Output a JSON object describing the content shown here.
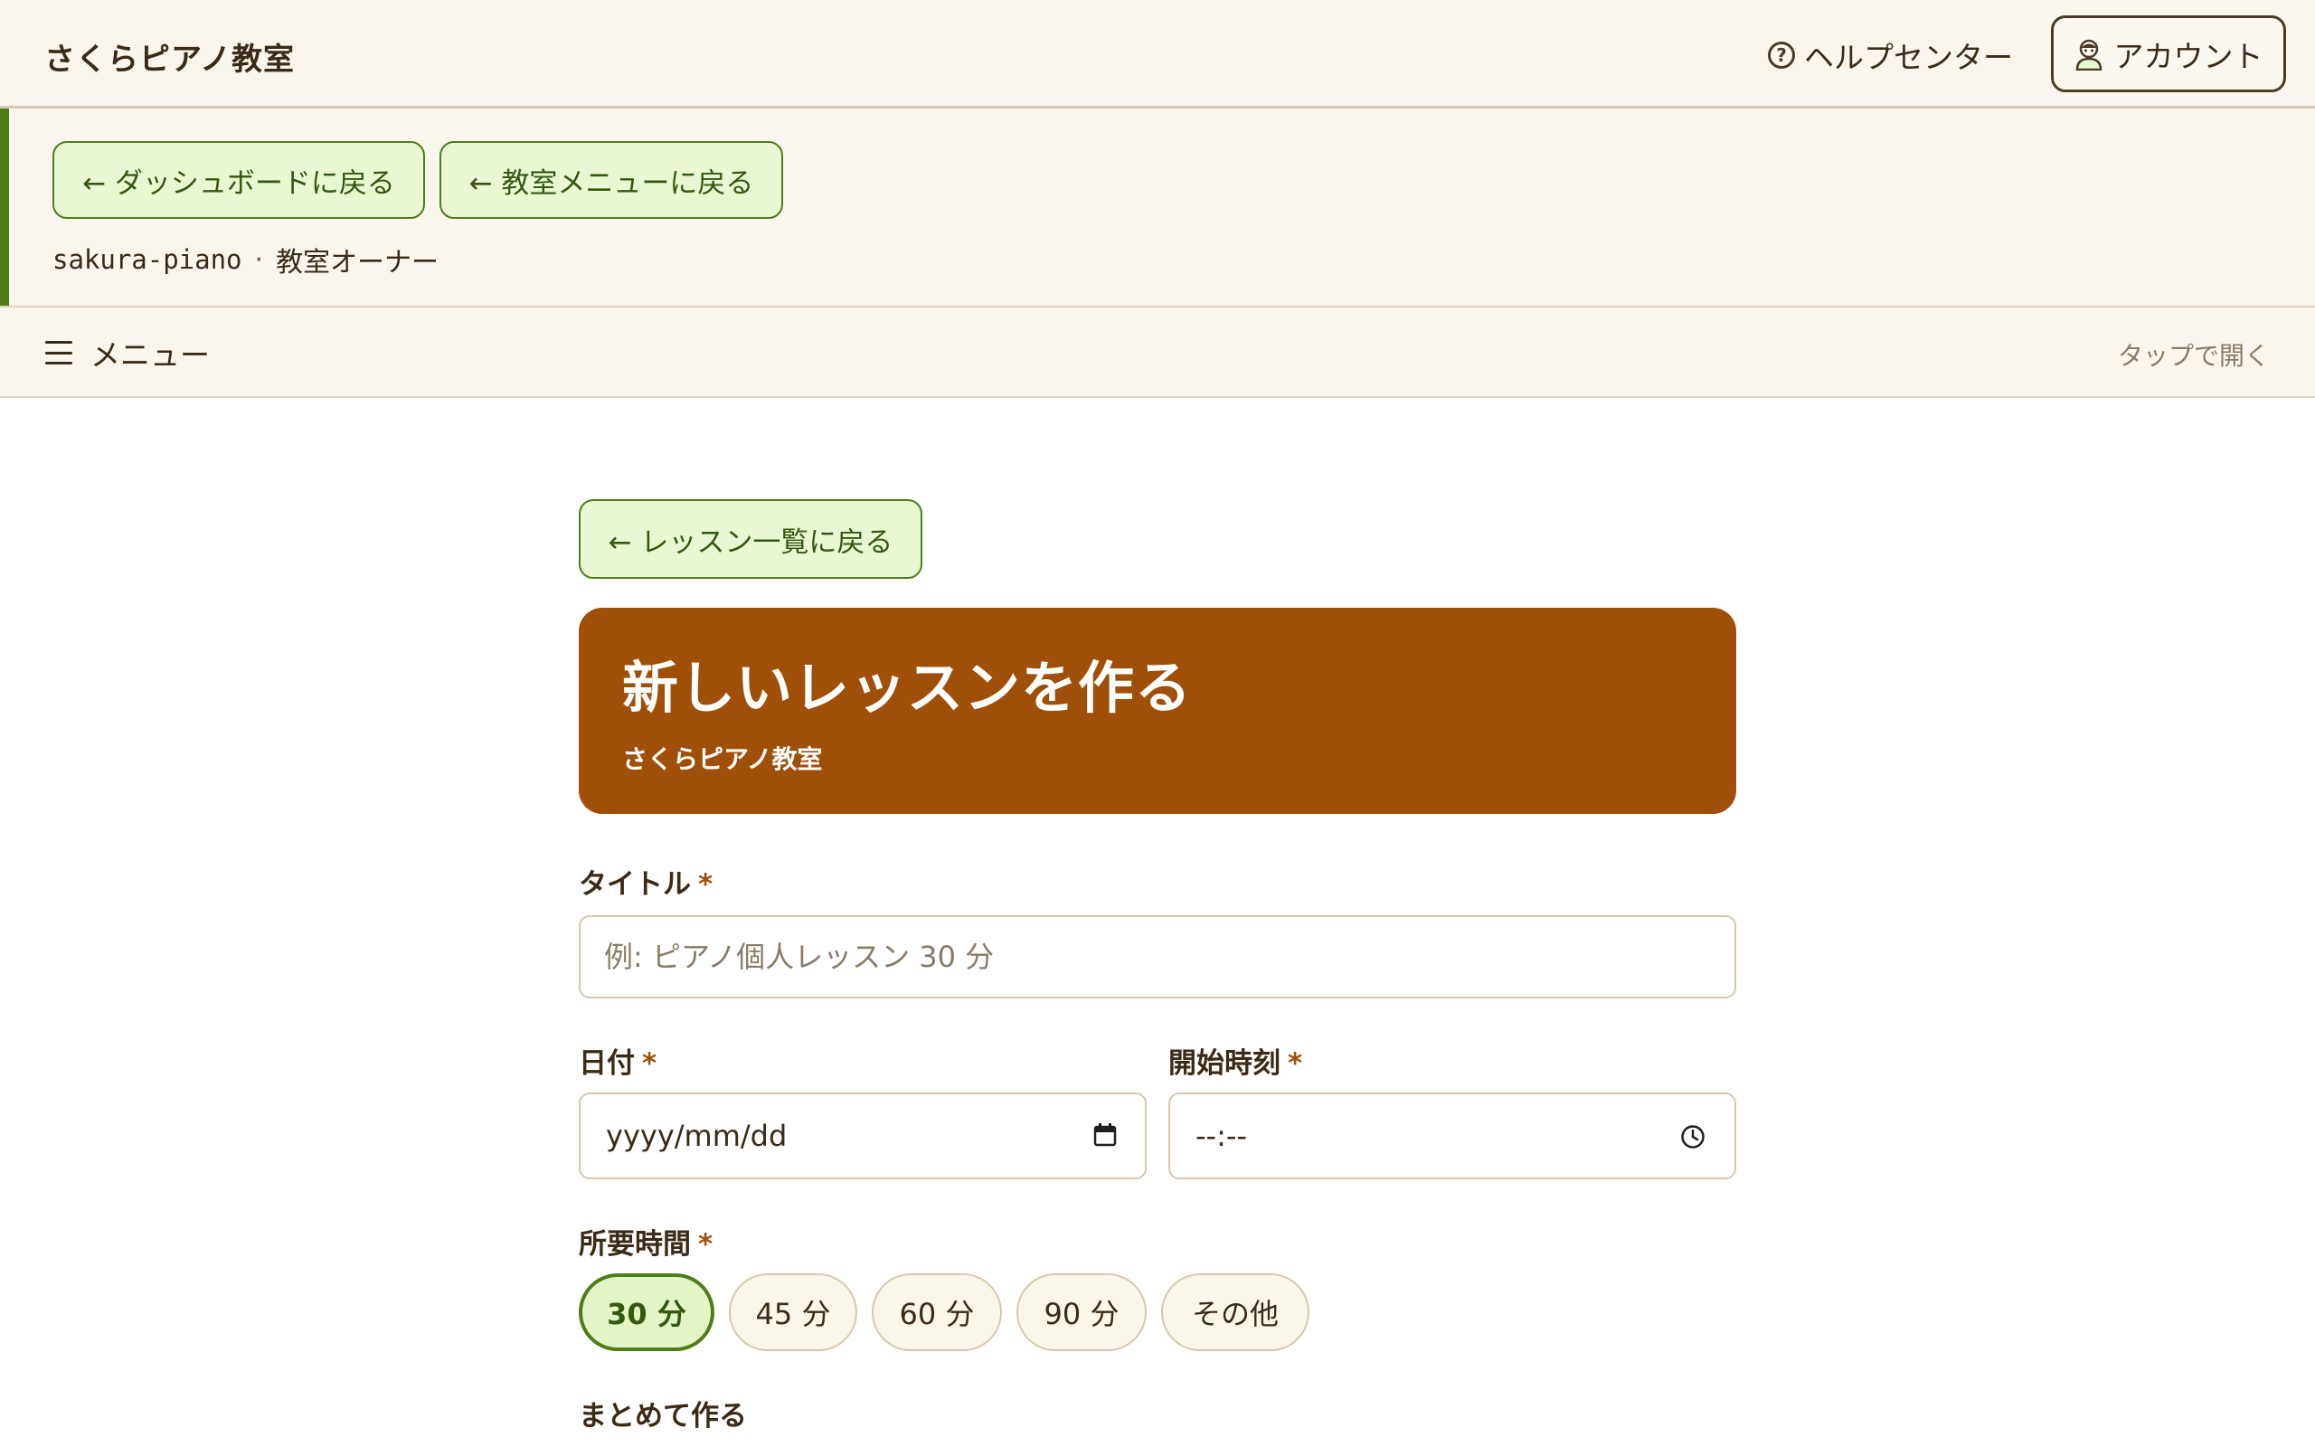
{
  "header": {
    "brand": "さくらピアノ教室",
    "help_label": "ヘルプセンター",
    "account_label": "アカウント"
  },
  "subnav": {
    "back_dashboard": "← ダッシュボードに戻る",
    "back_menu": "← 教室メニューに戻る",
    "owner_id": "sakura-piano",
    "separator": "·",
    "owner_role": "教室オーナー"
  },
  "menubar": {
    "menu_label": "メニュー",
    "tap_hint": "タップで開く"
  },
  "main": {
    "back_lessons": "← レッスン一覧に戻る",
    "hero_title": "新しいレッスンを作る",
    "hero_subtitle": "さくらピアノ教室",
    "required_mark": "*",
    "title_label": "タイトル",
    "title_placeholder": "例: ピアノ個人レッスン 30 分",
    "date_label": "日付",
    "date_value": "yyyy/mm/dd",
    "start_label": "開始時刻",
    "start_value": "--:--",
    "duration_label": "所要時間",
    "durations": [
      {
        "label": "30 分",
        "selected": true
      },
      {
        "label": "45 分",
        "selected": false
      },
      {
        "label": "60 分",
        "selected": false
      },
      {
        "label": "90 分",
        "selected": false
      },
      {
        "label": "その他",
        "selected": false
      }
    ],
    "batch_label": "まとめて作る"
  },
  "colors": {
    "accent_green": "#4d7d17",
    "hero_brown": "#a04f08",
    "page_bg": "#faf6ee"
  }
}
